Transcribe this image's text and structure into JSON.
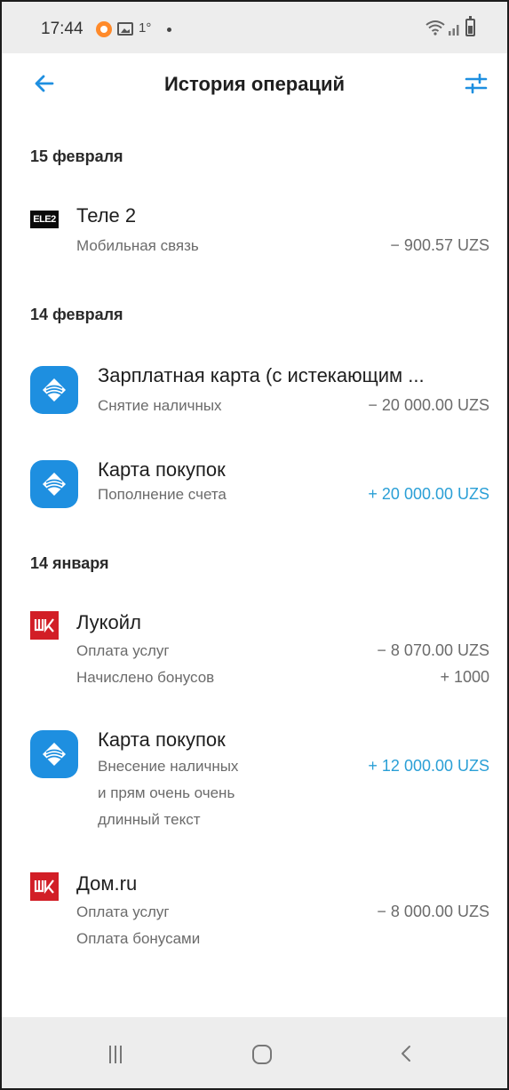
{
  "status_bar": {
    "time": "17:44",
    "temperature": "1°",
    "icons": [
      "notification-dot-icon",
      "gallery-icon",
      "wifi-icon",
      "signal-icon",
      "battery-icon"
    ]
  },
  "header": {
    "title": "История операций",
    "back_icon": "arrow-left-icon",
    "filter_icon": "sliders-icon",
    "accent_color": "#1e8fe0"
  },
  "groups": [
    {
      "date": "15 февраля",
      "operations": [
        {
          "icon": "tele2-logo",
          "logo_text": "ELE2",
          "name": "Теле 2",
          "details": [
            "Мобильная связь"
          ],
          "amounts": [
            "− 900.57 UZS"
          ]
        }
      ]
    },
    {
      "date": "14 февраля",
      "operations": [
        {
          "icon": "bank-card-icon",
          "name": "Зарплатная карта (с истекающим ...",
          "details": [
            "Снятие наличных"
          ],
          "amounts": [
            "− 20 000.00 UZS"
          ]
        },
        {
          "icon": "bank-card-icon",
          "name": "Карта покупок",
          "details": [
            "Пополнение счета"
          ],
          "amounts": [
            "+ 20 000.00 UZS"
          ]
        }
      ]
    },
    {
      "date": "14 января",
      "operations": [
        {
          "icon": "lukoil-logo",
          "name": "Лукойл",
          "details": [
            "Оплата услуг",
            "Начислено бонусов"
          ],
          "amounts": [
            "− 8 070.00 UZS",
            "+ 1000"
          ]
        },
        {
          "icon": "bank-card-icon",
          "name": "Карта покупок",
          "details": [
            "Внесение наличных",
            "и прям очень очень",
            "длинный текст"
          ],
          "amounts": [
            "+ 12 000.00 UZS"
          ]
        },
        {
          "icon": "lukoil-logo",
          "name": "Дом.ru",
          "details": [
            "Оплата услуг",
            "Оплата бонусами"
          ],
          "amounts": [
            "− 8 000.00 UZS"
          ]
        }
      ]
    }
  ],
  "colors": {
    "positive_amount": "#2a9fd6",
    "neutral_amount": "#6b6b6b",
    "bank_icon_bg": "#1e8fe0",
    "lukoil_red": "#d21e26"
  },
  "navbar": {
    "icons": [
      "recent-apps-icon",
      "home-icon",
      "back-icon"
    ]
  }
}
